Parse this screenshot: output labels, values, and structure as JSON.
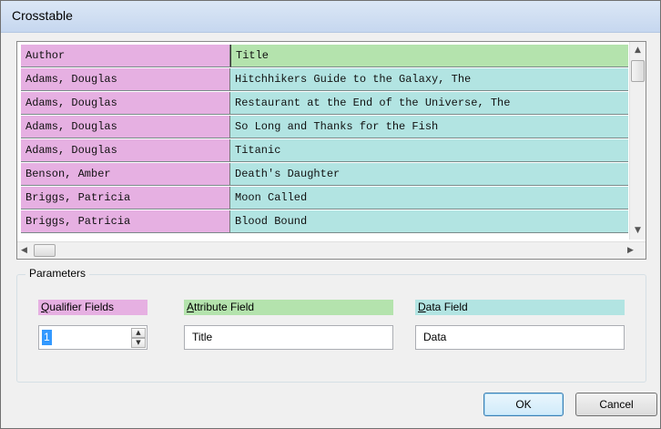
{
  "window": {
    "title": "Crosstable"
  },
  "grid": {
    "header": {
      "col1": "Author",
      "col2": "Title"
    },
    "rows": [
      {
        "author": "Adams, Douglas",
        "title": "Hitchhikers Guide to the Galaxy, The"
      },
      {
        "author": "Adams, Douglas",
        "title": "Restaurant at the End of the Universe, The"
      },
      {
        "author": "Adams, Douglas",
        "title": "So Long and Thanks for the Fish"
      },
      {
        "author": "Adams, Douglas",
        "title": "Titanic"
      },
      {
        "author": "Benson, Amber",
        "title": "Death's Daughter"
      },
      {
        "author": "Briggs, Patricia",
        "title": "Moon Called"
      },
      {
        "author": "Briggs, Patricia",
        "title": "Blood Bound"
      }
    ]
  },
  "parameters": {
    "group_label": "Parameters",
    "qualifier": {
      "label_first": "Q",
      "label_rest": "ualifier Fields",
      "value": "1"
    },
    "attribute": {
      "label_first": "A",
      "label_rest": "ttribute Field",
      "value": "Title"
    },
    "data": {
      "label_first": "D",
      "label_rest": "ata Field",
      "value": "Data"
    }
  },
  "buttons": {
    "ok": "OK",
    "cancel": "Cancel"
  },
  "colors": {
    "qualifier": "#e6b0e2",
    "attribute": "#b4e3ad",
    "data": "#b2e4e2",
    "selection": "#3399ff"
  },
  "icons": {
    "scroll_up": "triangle-up",
    "scroll_down": "triangle-down",
    "scroll_left": "triangle-left",
    "scroll_right": "triangle-right",
    "spin_up": "triangle-up",
    "spin_down": "triangle-down"
  }
}
